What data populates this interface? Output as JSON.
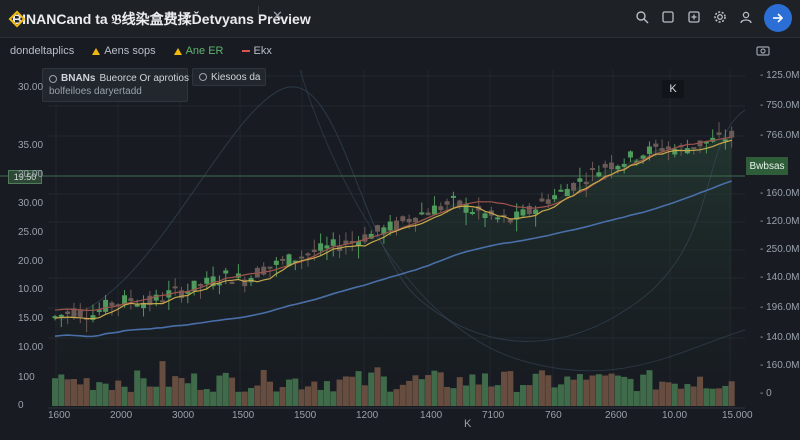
{
  "window": {
    "tab_title": "BINANCand ta 𝔅线染盒费揉Ďetvyans Preview",
    "icons": [
      "search-icon",
      "window-icon",
      "add-tab-icon",
      "settings-icon",
      "user-icon"
    ]
  },
  "indicators": {
    "items": [
      {
        "label": "dondeltaplics",
        "icon": ""
      },
      {
        "label": "Aens sops",
        "icon": "triangle-yellow-icon"
      },
      {
        "label": "Ane ER",
        "icon": "triangle-yellow-icon"
      },
      {
        "label": "Ekx",
        "icon": "red-dash-icon"
      }
    ]
  },
  "legend": {
    "primary_title": "BNANs",
    "primary_detail": "Bueorce Or aprotios",
    "primary_sub": "bolfeiloes daryertadd",
    "secondary": "Kiesoos da"
  },
  "price_tag_left": "19.50",
  "price_tag_right": "Bwbsas",
  "crosshair_tip": "K",
  "x_axis_marker": "K",
  "chart_data": {
    "type": "candlestick",
    "left_axis_ticks": [
      "30.00",
      "35.00",
      "20.00",
      "30.00",
      "25.00",
      "20.00",
      "10.00",
      "15.00",
      "10.00",
      "100",
      "0"
    ],
    "right_axis_ticks": [
      "125.0M",
      "750.0M",
      "766.0M",
      "160.0M",
      "120.0M",
      "250.0M",
      "140.0M",
      "196.0M",
      "140.0M",
      "160.0M",
      "0"
    ],
    "x_ticks": [
      "1600",
      "2000",
      "3000",
      "1500",
      "1500",
      "1200",
      "1400",
      "7100",
      "760",
      "2600",
      "10.00",
      "15.000"
    ],
    "series_colors": {
      "up": "#4f9a5c",
      "down": "#6b5a55",
      "ma_short": "#c9a94a",
      "ma_mid": "#a0524c",
      "ma_long": "#4a6fa8"
    },
    "close_trend": [
      10.5,
      11.2,
      10.8,
      12.0,
      12.4,
      12.1,
      13.0,
      13.5,
      14.2,
      15.0,
      14.6,
      15.8,
      16.5,
      17.2,
      17.8,
      18.4,
      19.0,
      19.8,
      20.5,
      21.6,
      22.3,
      23.0,
      22.2,
      21.4,
      21.0,
      22.0,
      23.4,
      24.5,
      25.8,
      27.0,
      27.6,
      28.4,
      29.0,
      28.8,
      29.4,
      29.9,
      30.4
    ]
  }
}
